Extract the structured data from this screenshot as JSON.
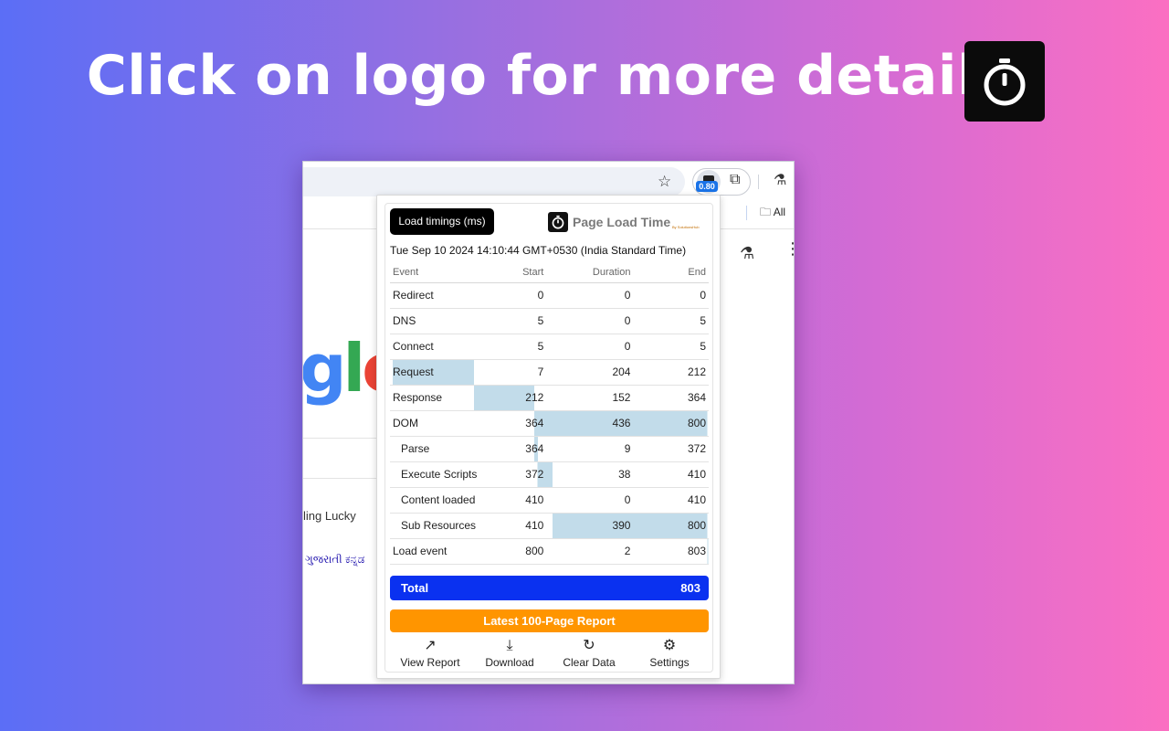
{
  "headline": "Click on logo for more details",
  "browser": {
    "extension_badge": "0.80",
    "bookmarks_folder": "All"
  },
  "background_page": {
    "logo_fragment": [
      "g",
      "l",
      "e"
    ],
    "lucky_text": "ling Lucky",
    "languages": "ગુજરાતી  ಕನ್ನಡ"
  },
  "popup": {
    "load_timings_button": "Load timings (ms)",
    "brand_name": "Page Load Time",
    "brand_sub": "By SolutionsHub",
    "timestamp": "Tue Sep 10 2024 14:10:44 GMT+0530 (India Standard Time)",
    "columns": [
      "Event",
      "Start",
      "Duration",
      "End"
    ],
    "rows": [
      {
        "event": "Redirect",
        "start": "0",
        "duration": "0",
        "end": "0",
        "sub": false
      },
      {
        "event": "DNS",
        "start": "5",
        "duration": "0",
        "end": "5",
        "sub": false
      },
      {
        "event": "Connect",
        "start": "5",
        "duration": "0",
        "end": "5",
        "sub": false
      },
      {
        "event": "Request",
        "start": "7",
        "duration": "204",
        "end": "212",
        "sub": false
      },
      {
        "event": "Response",
        "start": "212",
        "duration": "152",
        "end": "364",
        "sub": false
      },
      {
        "event": "DOM",
        "start": "364",
        "duration": "436",
        "end": "800",
        "sub": false
      },
      {
        "event": "Parse",
        "start": "364",
        "duration": "9",
        "end": "372",
        "sub": true
      },
      {
        "event": "Execute Scripts",
        "start": "372",
        "duration": "38",
        "end": "410",
        "sub": true
      },
      {
        "event": "Content loaded",
        "start": "410",
        "duration": "0",
        "end": "410",
        "sub": true
      },
      {
        "event": "Sub Resources",
        "start": "410",
        "duration": "390",
        "end": "800",
        "sub": true
      },
      {
        "event": "Load event",
        "start": "800",
        "duration": "2",
        "end": "803",
        "sub": false
      }
    ],
    "total_label": "Total",
    "total_value": "803",
    "report_button": "Latest 100-Page Report",
    "actions": [
      {
        "label": "View Report",
        "icon": "arrow-up-right-icon"
      },
      {
        "label": "Download",
        "icon": "download-icon"
      },
      {
        "label": "Clear Data",
        "icon": "refresh-icon"
      },
      {
        "label": "Settings",
        "icon": "gear-icon"
      }
    ]
  },
  "colors": {
    "timeline_bar": "#c2dcea",
    "total_bg": "#0a31f0",
    "report_bg": "#ff9500"
  }
}
